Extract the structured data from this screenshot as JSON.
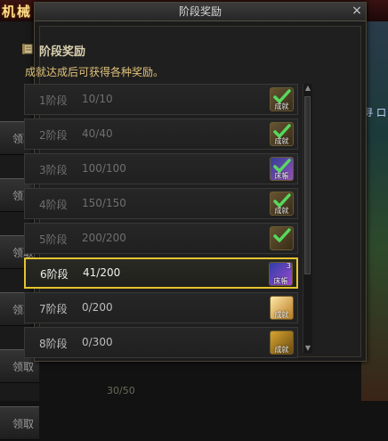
{
  "background": {
    "title_text": "机械",
    "claim_label": "领取",
    "claim_count": 6,
    "right_text": "寻 口",
    "bottom_number": "30/50"
  },
  "dialog": {
    "title": "阶段奖励",
    "close_glyph": "×",
    "header_title": "阶段奖励",
    "subtitle": "成就达成后可获得各种奖励。"
  },
  "stages": [
    {
      "stage": "1阶段",
      "progress": "10/10",
      "state": "done",
      "badge": "ach",
      "badge_label": "成就",
      "checked": true
    },
    {
      "stage": "2阶段",
      "progress": "40/40",
      "state": "done",
      "badge": "ach",
      "badge_label": "成就",
      "checked": true
    },
    {
      "stage": "3阶段",
      "progress": "100/100",
      "state": "done",
      "badge": "item",
      "badge_label": "床帳",
      "checked": true
    },
    {
      "stage": "4阶段",
      "progress": "150/150",
      "state": "done",
      "badge": "ach",
      "badge_label": "成就",
      "checked": true
    },
    {
      "stage": "5阶段",
      "progress": "200/200",
      "state": "done",
      "badge": "ach",
      "badge_label": "",
      "checked": true
    },
    {
      "stage": "6阶段",
      "progress": "41/200",
      "state": "active",
      "badge": "item",
      "badge_label": "床帳",
      "checked": false,
      "qty": "3"
    },
    {
      "stage": "7阶段",
      "progress": "0/200",
      "state": "pending",
      "badge": "light",
      "badge_label": "成就",
      "checked": false
    },
    {
      "stage": "8阶段",
      "progress": "0/300",
      "state": "pending",
      "badge": "gold",
      "badge_label": "成就",
      "checked": false
    }
  ],
  "scrollbar": {
    "up_glyph": "▲",
    "down_glyph": "▼"
  }
}
